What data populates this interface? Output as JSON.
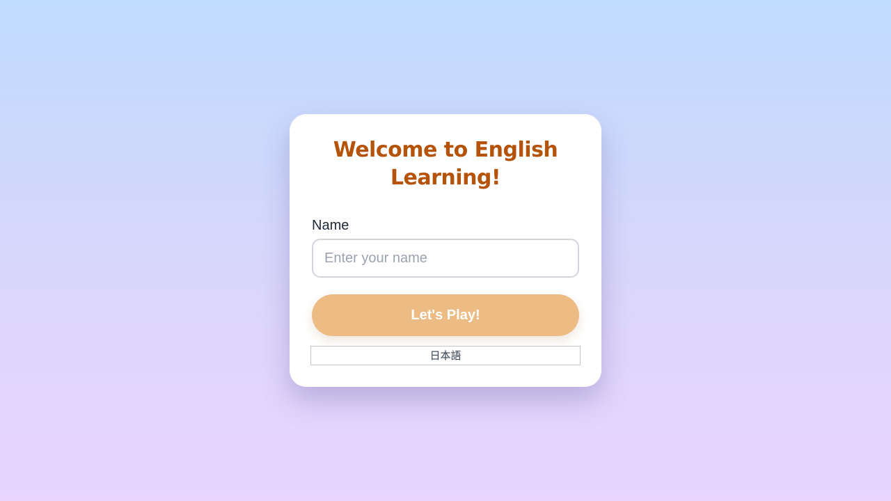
{
  "card": {
    "title_line1": "Welcome to English",
    "title_line2": "Learning!"
  },
  "form": {
    "name_label": "Name",
    "name_value": "",
    "name_placeholder": "Enter your name",
    "play_button_label": "Let's Play!",
    "language_button_label": "日本語"
  },
  "colors": {
    "title": "#b45309",
    "play_button": "#ecbc84",
    "background_top": "#bfdbfe",
    "background_bottom": "#e9d5ff"
  }
}
